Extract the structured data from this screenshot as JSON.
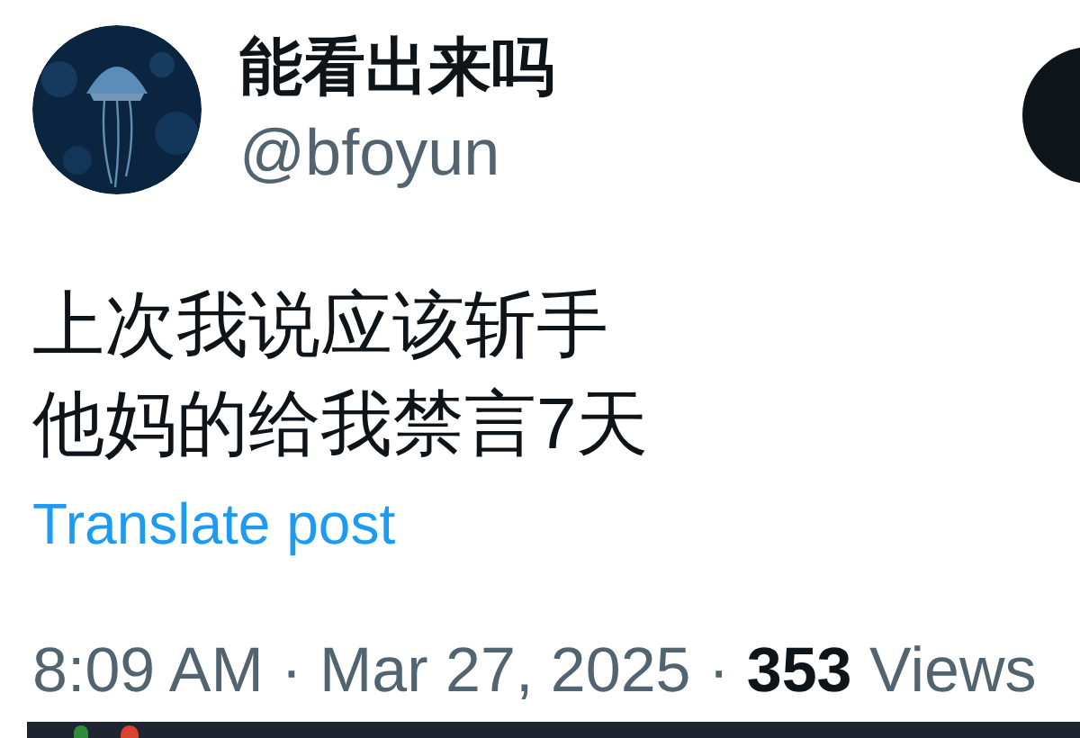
{
  "author": {
    "name": "能看出来吗",
    "handle": "@bfoyun"
  },
  "post": {
    "lines": [
      "上次我说应该斩手",
      "他妈的给我禁言7天"
    ],
    "translate_link": "Translate post"
  },
  "meta": "8:09 AM · Mar 27, 2025 · **353** Views"
}
